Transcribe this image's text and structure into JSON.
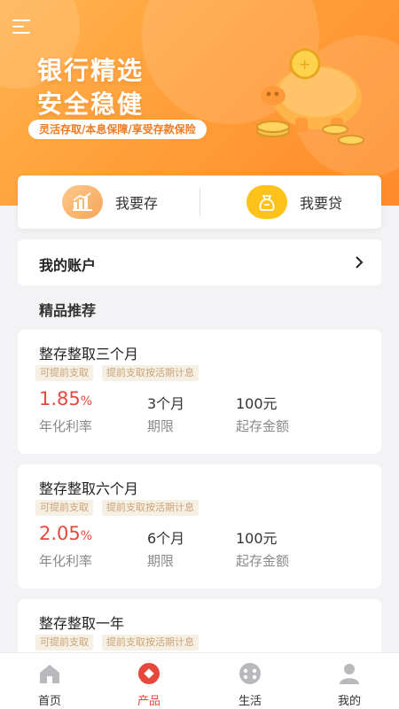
{
  "hero": {
    "title_line1": "银行精选",
    "title_line2": "安全稳健",
    "tagline": "灵活存取/本息保障/享受存款保险"
  },
  "actions": {
    "deposit_label": "我要存",
    "loan_label": "我要贷"
  },
  "account": {
    "label": "我的账户"
  },
  "recommend": {
    "title": "精品推荐",
    "products": [
      {
        "name": "整存整取三个月",
        "tags": [
          "可提前支取",
          "提前支取按活期计息"
        ],
        "rate_value": "1.85",
        "rate_unit": "%",
        "rate_caption": "年化利率",
        "term": "3个月",
        "term_caption": "期限",
        "min_amount": "100元",
        "min_caption": "起存金额"
      },
      {
        "name": "整存整取六个月",
        "tags": [
          "可提前支取",
          "提前支取按活期计息"
        ],
        "rate_value": "2.05",
        "rate_unit": "%",
        "rate_caption": "年化利率",
        "term": "6个月",
        "term_caption": "期限",
        "min_amount": "100元",
        "min_caption": "起存金额"
      },
      {
        "name": "整存整取一年",
        "tags": [
          "可提前支取",
          "提前支取按活期计息"
        ]
      }
    ]
  },
  "tabbar": {
    "items": [
      {
        "label": "首页",
        "icon": "home-icon"
      },
      {
        "label": "产品",
        "icon": "product-icon"
      },
      {
        "label": "生活",
        "icon": "life-icon"
      },
      {
        "label": "我的",
        "icon": "profile-icon"
      }
    ],
    "active_index": 1
  },
  "colors": {
    "accent": "#ff9f3a",
    "rate_red": "#e8473b",
    "tag_bg": "#f6efe4",
    "tag_text": "#c9a47a",
    "loan_icon": "#ffc21a"
  }
}
